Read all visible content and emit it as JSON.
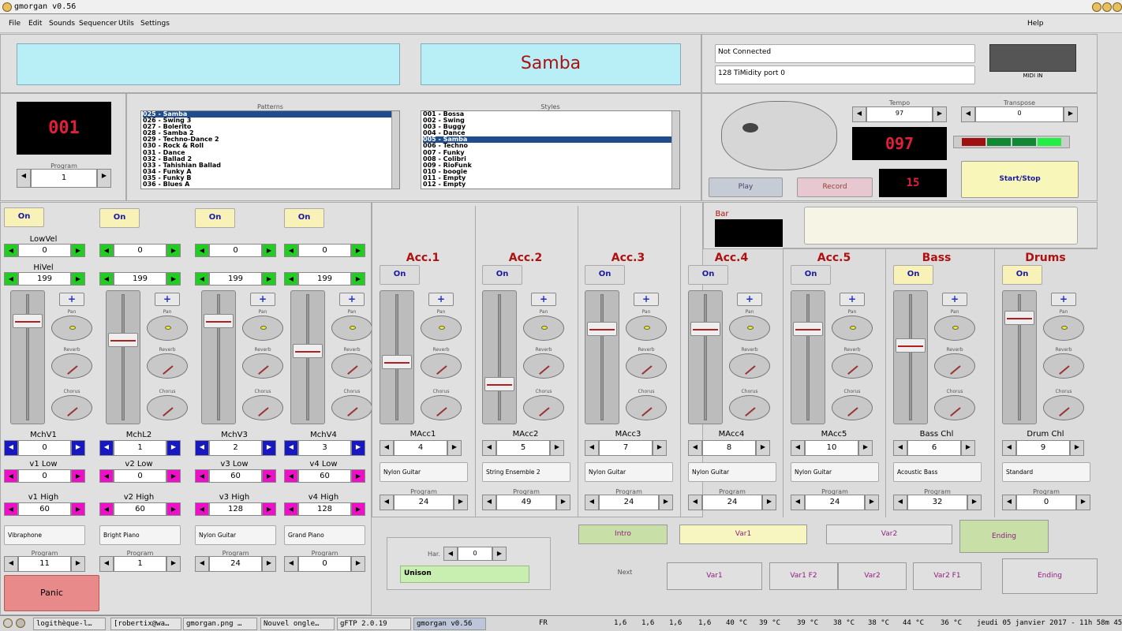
{
  "window": {
    "title": "gmorgan v0.56"
  },
  "menu": [
    "File",
    "Edit",
    "Sounds",
    "Sequencer",
    "Utils",
    "Settings"
  ],
  "help": "Help",
  "display": {
    "style_name": "Samba",
    "program_led": "001",
    "program_label": "Program",
    "program_value": "1"
  },
  "connection": {
    "status": "Not Connected",
    "port": "128 TiMidity port 0",
    "midi_in": "MIDI IN"
  },
  "patterns": {
    "label": "Patterns",
    "items": [
      "025 - Samba",
      "026 - Swing 3",
      "027 - Bolerito",
      "028 - Samba 2",
      "029 - Techno-Dance 2",
      "030 - Rock & Roll",
      "031 - Dance",
      "032 - Ballad 2",
      "033 - Tahishian Ballad",
      "034 - Funky A",
      "035 - Funky B",
      "036 - Blues A"
    ],
    "selected": 0
  },
  "styles": {
    "label": "Styles",
    "items": [
      "001 - Bossa",
      "002 - Swing",
      "003 - Buggy",
      "004 - Dance",
      "005 - Samba",
      "006 - Techno",
      "007 - Funky",
      "008 - Colibri",
      "009 - RioFunk",
      "010 - boogie",
      "011 - Empty",
      "012 - Empty"
    ],
    "selected": 4
  },
  "tempo": {
    "label": "Tempo",
    "value": "97",
    "led": "097"
  },
  "transpose": {
    "label": "Transpose",
    "value": "0"
  },
  "bar_led": "15",
  "buttons": {
    "play": "Play",
    "record": "Record",
    "start_stop": "Start/Stop",
    "panic": "Panic",
    "next": "Next"
  },
  "bar_label": "Bar",
  "manual_channels": [
    {
      "on": "On",
      "lowvel_label": "LowVel",
      "lowvel": "0",
      "hivel_label": "HiVel",
      "hivel": "199",
      "mch_label": "MchV1",
      "mch": "0",
      "low_label": "v1 Low",
      "low": "0",
      "high_label": "v1 High",
      "high": "60",
      "instrument": "Vibraphone",
      "prog": "11"
    },
    {
      "on": "On",
      "lowvel_label": "",
      "lowvel": "0",
      "hivel_label": "",
      "hivel": "199",
      "mch_label": "MchL2",
      "mch": "1",
      "low_label": "v2 Low",
      "low": "0",
      "high_label": "v2 High",
      "high": "60",
      "instrument": "Bright Piano",
      "prog": "1"
    },
    {
      "on": "On",
      "lowvel_label": "",
      "lowvel": "0",
      "hivel_label": "",
      "hivel": "199",
      "mch_label": "MchV3",
      "mch": "2",
      "low_label": "v3 Low",
      "low": "60",
      "high_label": "v3 High",
      "high": "128",
      "instrument": "Nylon Guitar",
      "prog": "24"
    },
    {
      "on": "On",
      "lowvel_label": "",
      "lowvel": "0",
      "hivel_label": "",
      "hivel": "199",
      "mch_label": "MchV4",
      "mch": "3",
      "low_label": "v4 Low",
      "low": "60",
      "high_label": "v4 High",
      "high": "128",
      "instrument": "Grand Piano",
      "prog": "0"
    }
  ],
  "knob_labels": {
    "pan": "Pan",
    "reverb": "Reverb",
    "chorus": "Chorus",
    "program": "Program"
  },
  "acc_channels": [
    {
      "title": "Acc.1",
      "on": "On",
      "ch_label": "MAcc1",
      "ch": "4",
      "instrument": "Nylon Guitar",
      "prog": "24",
      "fader": 0.45
    },
    {
      "title": "Acc.2",
      "on": "On",
      "ch_label": "MAcc2",
      "ch": "5",
      "instrument": "String Ensemble 2",
      "prog": "49",
      "fader": 0.25
    },
    {
      "title": "Acc.3",
      "on": "On",
      "ch_label": "MAcc3",
      "ch": "7",
      "instrument": "Nylon Guitar",
      "prog": "24",
      "fader": 0.75
    },
    {
      "title": "Acc.4",
      "on": "On",
      "ch_label": "MAcc4",
      "ch": "8",
      "instrument": "Nylon Guitar",
      "prog": "24",
      "fader": 0.75
    },
    {
      "title": "Acc.5",
      "on": "On",
      "ch_label": "MAcc5",
      "ch": "10",
      "instrument": "Nylon Guitar",
      "prog": "24",
      "fader": 0.75
    },
    {
      "title": "Bass",
      "on": "On",
      "ch_label": "Bass Chl",
      "ch": "6",
      "instrument": "Acoustic Bass",
      "prog": "32",
      "fader": 0.6
    },
    {
      "title": "Drums",
      "on": "On",
      "ch_label": "Drum Chl",
      "ch": "9",
      "instrument": "Standard",
      "prog": "0",
      "fader": 0.85
    }
  ],
  "harmony": {
    "label": "Har.",
    "value": "0",
    "mode": "Unison"
  },
  "variations": {
    "intro": "Intro",
    "var1": "Var1",
    "var2": "Var2",
    "ending": "Ending",
    "next_var1": "Var1",
    "next_var1f2": "Var1 F2",
    "next_var2": "Var2",
    "next_var2f1": "Var2 F1",
    "next_ending": "Ending"
  },
  "taskbar": {
    "tasks": [
      "logithèque-l…",
      "[robertix@wa…",
      "gmorgan.png …",
      "Nouvel ongle…",
      "gFTP 2.0.19",
      "gmorgan v0.56"
    ],
    "lang": "FR",
    "sensors": [
      "1,6",
      "1,6",
      "1,6",
      "1,6",
      "40 °C",
      "39 °C",
      "39 °C",
      "38 °C",
      "38 °C",
      "44 °C",
      "36 °C"
    ],
    "clock": "jeudi 05 janvier 2017 - 11h 58m 45s"
  },
  "colors": {
    "led_text": "#e0203a",
    "title_red": "#b01010",
    "cyan": "#b8eef6",
    "on_yellow": "#f8f2b8"
  }
}
